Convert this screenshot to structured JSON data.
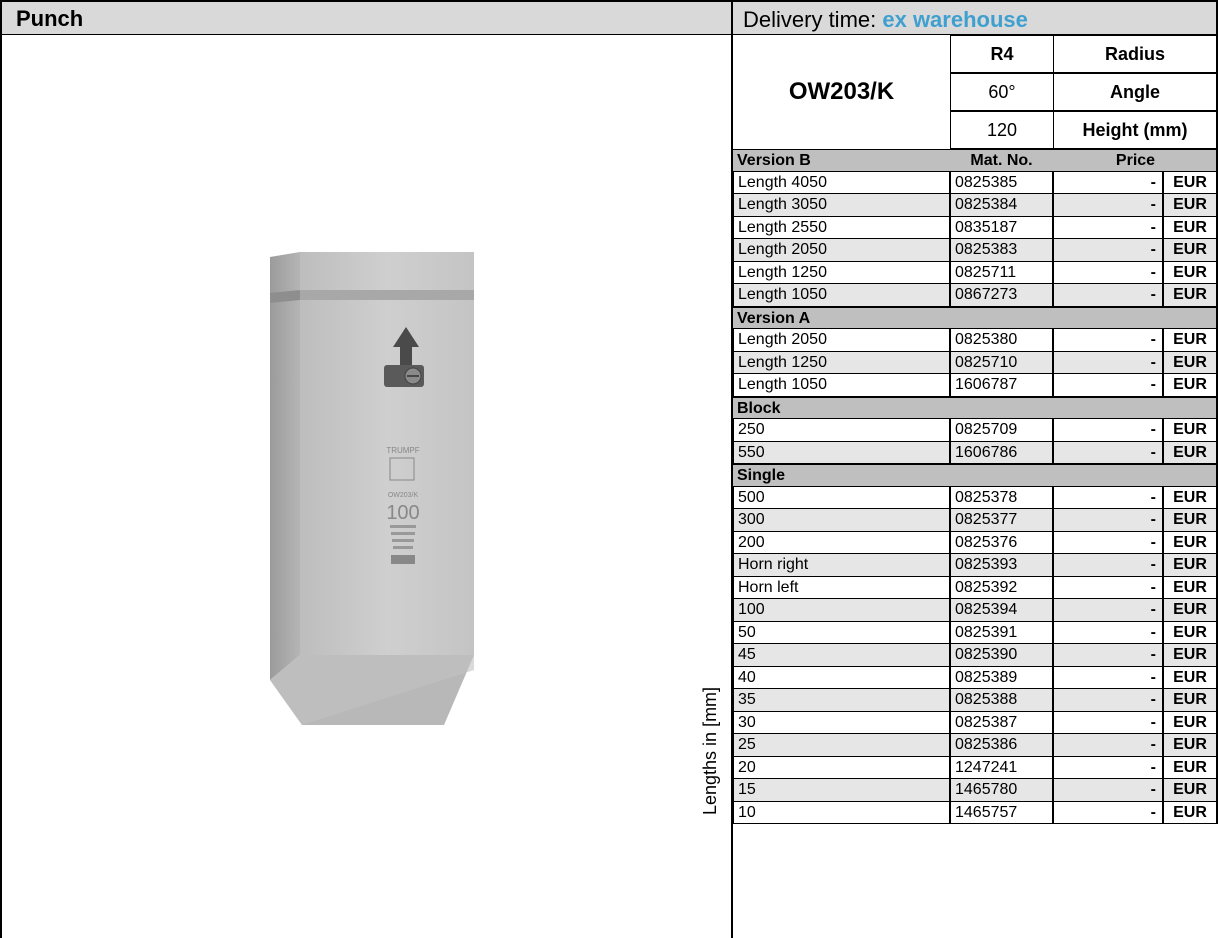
{
  "header": {
    "product": "Punch",
    "delivery_label": "Delivery time: ",
    "delivery_value": "ex warehouse"
  },
  "spec": {
    "model": "OW203/K",
    "rows": [
      {
        "value": "R4",
        "label": "Radius"
      },
      {
        "value": "60°",
        "label": "Angle"
      },
      {
        "value": "120",
        "label": "Height (mm)"
      }
    ]
  },
  "engraving": {
    "brand": "TRUMPF",
    "model": "OW203/K",
    "height": "100"
  },
  "side_label": "Lengths in [mm]",
  "table": {
    "sections": [
      {
        "title": "Version B",
        "col2": "Mat. No.",
        "col3": "Price",
        "items": [
          {
            "name": "Length 4050",
            "mat": "0825385",
            "price": "-",
            "currency": "EUR"
          },
          {
            "name": "Length 3050",
            "mat": "0825384",
            "price": "-",
            "currency": "EUR"
          },
          {
            "name": "Length 2550",
            "mat": "0835187",
            "price": "-",
            "currency": "EUR"
          },
          {
            "name": "Length 2050",
            "mat": "0825383",
            "price": "-",
            "currency": "EUR"
          },
          {
            "name": "Length 1250",
            "mat": "0825711",
            "price": "-",
            "currency": "EUR"
          },
          {
            "name": "Length 1050",
            "mat": "0867273",
            "price": "-",
            "currency": "EUR"
          }
        ]
      },
      {
        "title": "Version A",
        "items": [
          {
            "name": "Length 2050",
            "mat": "0825380",
            "price": "-",
            "currency": "EUR"
          },
          {
            "name": "Length 1250",
            "mat": "0825710",
            "price": "-",
            "currency": "EUR"
          },
          {
            "name": "Length 1050",
            "mat": "1606787",
            "price": "-",
            "currency": "EUR"
          }
        ]
      },
      {
        "title": "Block",
        "items": [
          {
            "name": "250",
            "mat": "0825709",
            "price": "-",
            "currency": "EUR"
          },
          {
            "name": "550",
            "mat": "1606786",
            "price": "-",
            "currency": "EUR"
          }
        ]
      },
      {
        "title": "Single",
        "items": [
          {
            "name": "500",
            "mat": "0825378",
            "price": "-",
            "currency": "EUR"
          },
          {
            "name": "300",
            "mat": "0825377",
            "price": "-",
            "currency": "EUR"
          },
          {
            "name": "200",
            "mat": "0825376",
            "price": "-",
            "currency": "EUR"
          },
          {
            "name": "Horn right",
            "mat": "0825393",
            "price": "-",
            "currency": "EUR"
          },
          {
            "name": "Horn left",
            "mat": "0825392",
            "price": "-",
            "currency": "EUR"
          },
          {
            "name": "100",
            "mat": "0825394",
            "price": "-",
            "currency": "EUR"
          },
          {
            "name": "50",
            "mat": "0825391",
            "price": "-",
            "currency": "EUR"
          },
          {
            "name": "45",
            "mat": "0825390",
            "price": "-",
            "currency": "EUR"
          },
          {
            "name": "40",
            "mat": "0825389",
            "price": "-",
            "currency": "EUR"
          },
          {
            "name": "35",
            "mat": "0825388",
            "price": "-",
            "currency": "EUR"
          },
          {
            "name": "30",
            "mat": "0825387",
            "price": "-",
            "currency": "EUR"
          },
          {
            "name": "25",
            "mat": "0825386",
            "price": "-",
            "currency": "EUR"
          },
          {
            "name": "20",
            "mat": "1247241",
            "price": "-",
            "currency": "EUR"
          },
          {
            "name": "15",
            "mat": "1465780",
            "price": "-",
            "currency": "EUR"
          },
          {
            "name": "10",
            "mat": "1465757",
            "price": "-",
            "currency": "EUR"
          }
        ]
      }
    ]
  },
  "colors": {
    "header_bg": "#d9d9d9",
    "section_bg": "#bfbfbf",
    "row_shade": "#e6e6e6",
    "accent": "#3fa0d0"
  }
}
